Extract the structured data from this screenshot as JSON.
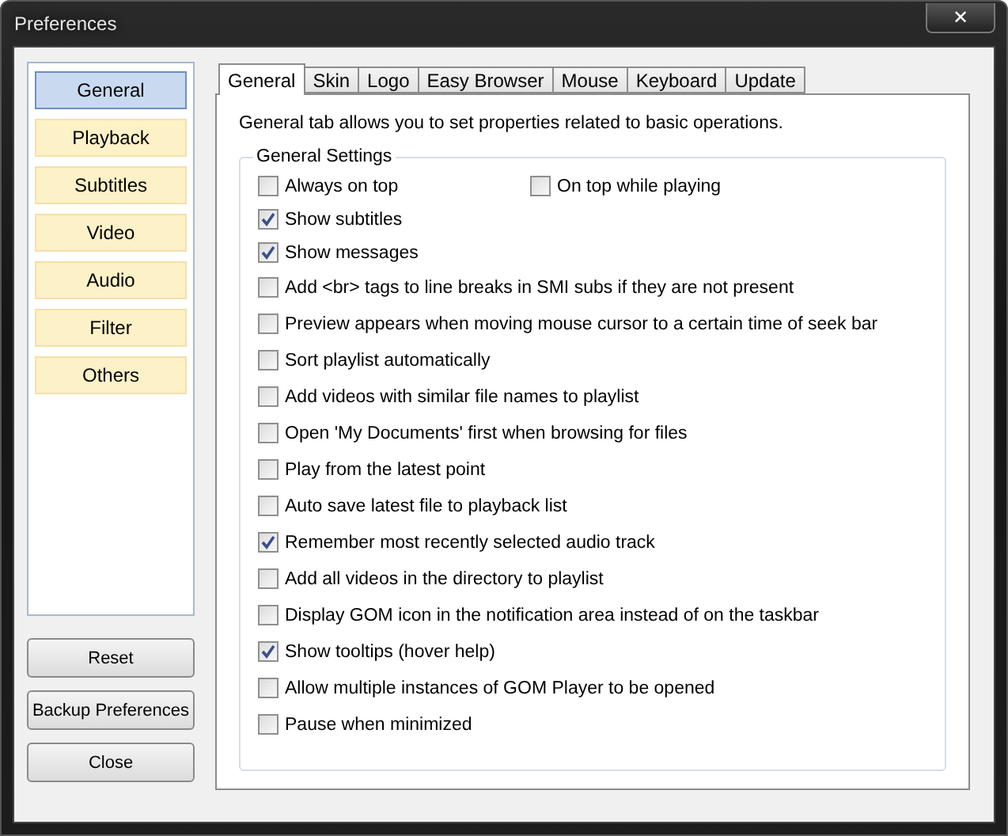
{
  "window": {
    "title": "Preferences",
    "close_glyph": "✕"
  },
  "categories": [
    {
      "label": "General",
      "selected": true
    },
    {
      "label": "Playback",
      "selected": false
    },
    {
      "label": "Subtitles",
      "selected": false
    },
    {
      "label": "Video",
      "selected": false
    },
    {
      "label": "Audio",
      "selected": false
    },
    {
      "label": "Filter",
      "selected": false
    },
    {
      "label": "Others",
      "selected": false
    }
  ],
  "buttons": [
    "Reset",
    "Backup Preferences",
    "Close"
  ],
  "tabs": [
    {
      "label": "General",
      "selected": true
    },
    {
      "label": "Skin",
      "selected": false
    },
    {
      "label": "Logo",
      "selected": false
    },
    {
      "label": "Easy Browser",
      "selected": false
    },
    {
      "label": "Mouse",
      "selected": false
    },
    {
      "label": "Keyboard",
      "selected": false
    },
    {
      "label": "Update",
      "selected": false
    }
  ],
  "description": "General tab allows you to set properties related to basic operations.",
  "group": {
    "title": "General Settings",
    "rows": [
      {
        "items": [
          {
            "label": "Always on top",
            "checked": false
          },
          {
            "label": "On top while playing",
            "checked": false
          }
        ]
      },
      {
        "items": [
          {
            "label": "Show subtitles",
            "checked": true
          }
        ]
      },
      {
        "items": [
          {
            "label": "Show messages",
            "checked": true
          }
        ]
      },
      {
        "items": [
          {
            "label": "Add <br> tags to line breaks in SMI subs if they are not present",
            "checked": false
          }
        ]
      },
      {
        "items": [
          {
            "label": "Preview appears when moving mouse cursor to a certain time of seek bar",
            "checked": false
          }
        ]
      },
      {
        "items": [
          {
            "label": "Sort playlist automatically",
            "checked": false
          }
        ]
      },
      {
        "items": [
          {
            "label": "Add videos with similar file names to playlist",
            "checked": false
          }
        ]
      },
      {
        "items": [
          {
            "label": "Open 'My Documents' first when browsing for files",
            "checked": false
          }
        ]
      },
      {
        "items": [
          {
            "label": "Play from the latest point",
            "checked": false
          }
        ]
      },
      {
        "items": [
          {
            "label": "Auto save latest file to playback list",
            "checked": false
          }
        ]
      },
      {
        "items": [
          {
            "label": "Remember most recently selected audio track",
            "checked": true
          }
        ]
      },
      {
        "items": [
          {
            "label": "Add all videos in the directory to playlist",
            "checked": false
          }
        ]
      },
      {
        "items": [
          {
            "label": "Display GOM icon in the notification area instead of on the taskbar",
            "checked": false
          }
        ]
      },
      {
        "items": [
          {
            "label": "Show tooltips (hover help)",
            "checked": true
          }
        ]
      },
      {
        "items": [
          {
            "label": "Allow multiple instances of GOM Player to be opened",
            "checked": false
          }
        ]
      },
      {
        "items": [
          {
            "label": "Pause when minimized",
            "checked": false
          }
        ]
      }
    ]
  }
}
